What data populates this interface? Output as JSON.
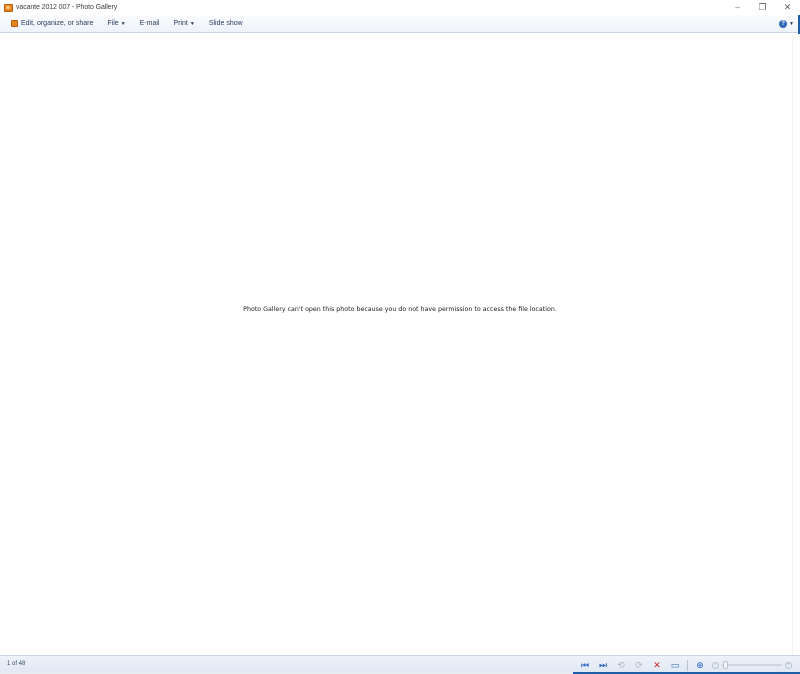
{
  "window": {
    "title": "vacante 2012 007 - Photo Gallery",
    "controls": {
      "minimize": "–",
      "restore": "❐",
      "close": "✕"
    }
  },
  "command_bar": {
    "items": [
      {
        "label": "Edit, organize, or share",
        "icon": "photo-gallery-icon"
      },
      {
        "label": "File",
        "dropdown": true
      },
      {
        "label": "E-mail"
      },
      {
        "label": "Print",
        "dropdown": true
      },
      {
        "label": "Slide show"
      }
    ],
    "help_label": "?"
  },
  "viewer": {
    "message": "Photo Gallery can't open this photo because you do not have permission to access the file location."
  },
  "status_bar": {
    "counter": "1 of 48",
    "controls": {
      "previous": "⏮",
      "next": "⏭",
      "rotate_left": "⟲",
      "rotate_right": "⟳",
      "delete": "✕",
      "slideshow": "▭",
      "actual_size": "⊕"
    },
    "zoom": {
      "minus": "−",
      "plus": "+",
      "level": 0
    }
  },
  "colors": {
    "accent": "#2a64c4",
    "delete": "#d0202a",
    "app_icon": "#e2861f"
  }
}
